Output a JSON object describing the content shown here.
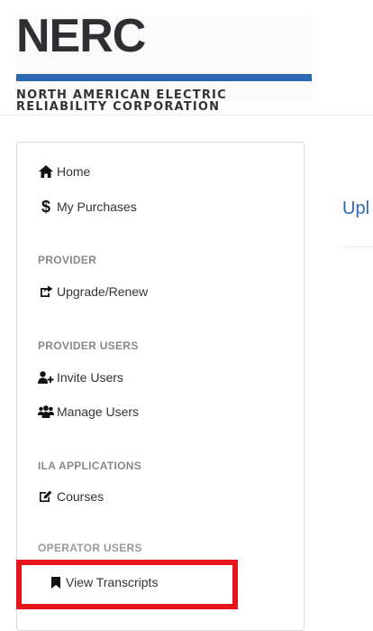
{
  "logo": {
    "mark": "NERC",
    "line1": "NORTH AMERICAN ELECTRIC",
    "line2": "RELIABILITY CORPORATION"
  },
  "sidebar": {
    "home": "Home",
    "purchases": "My Purchases",
    "provider_header": "PROVIDER",
    "upgrade": "Upgrade/Renew",
    "provider_users_header": "PROVIDER USERS",
    "invite": "Invite Users",
    "manage": "Manage Users",
    "ila_header": "ILA APPLICATIONS",
    "courses": "Courses",
    "operator_header": "OPERATOR USERS",
    "transcripts": "View Transcripts"
  },
  "main": {
    "title": "Upl"
  },
  "colors": {
    "accent": "#2d68b3",
    "highlight": "#e8141c",
    "section_header": "#888888"
  },
  "icons": {
    "home": "home-icon",
    "purchases": "dollar-icon",
    "upgrade": "share-square-icon",
    "invite": "user-plus-icon",
    "manage": "users-icon",
    "courses": "edit-icon",
    "transcripts": "bookmark-icon"
  }
}
